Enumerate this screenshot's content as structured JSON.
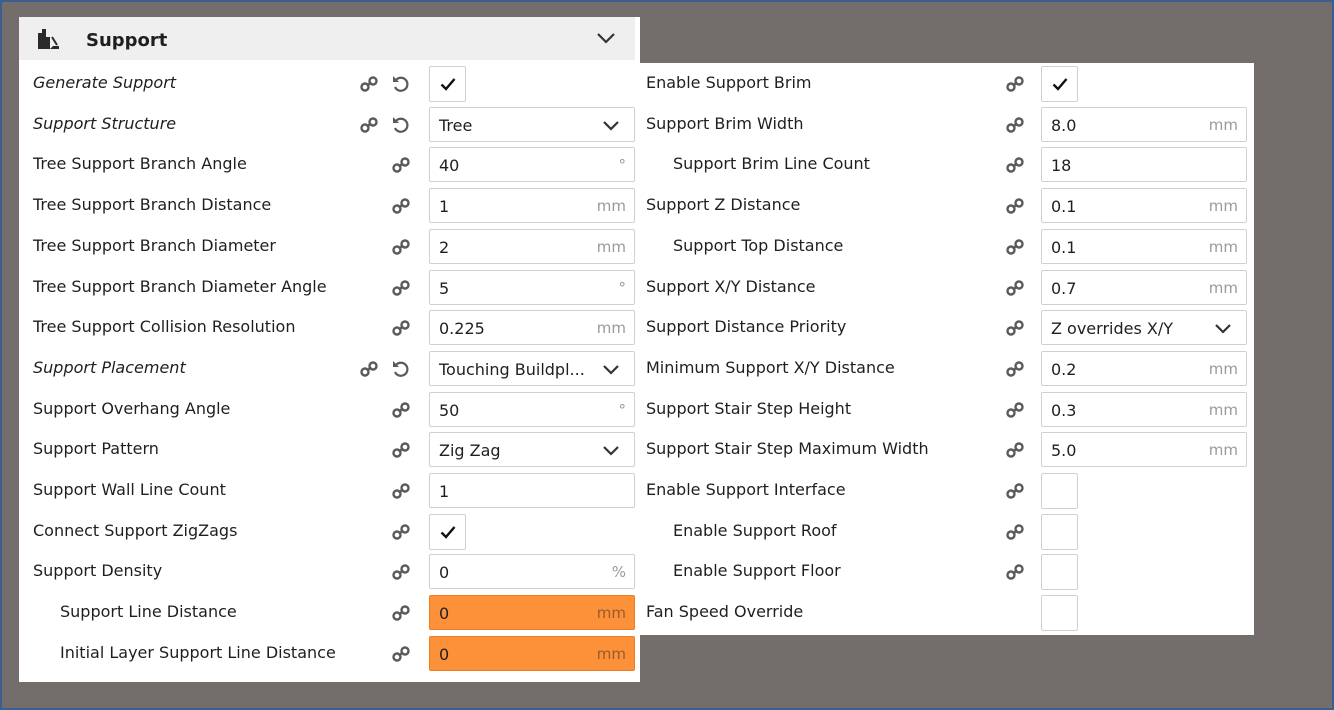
{
  "category": {
    "title": "Support",
    "icon": "support-category-icon"
  },
  "left_settings": [
    {
      "label": "Generate Support",
      "type": "checkbox",
      "checked": true,
      "italic": true,
      "reset": true
    },
    {
      "label": "Support Structure",
      "type": "dropdown",
      "value": "Tree",
      "italic": true,
      "reset": true
    },
    {
      "label": "Tree Support Branch Angle",
      "type": "number",
      "value": "40",
      "unit": "°"
    },
    {
      "label": "Tree Support Branch Distance",
      "type": "number",
      "value": "1",
      "unit": "mm"
    },
    {
      "label": "Tree Support Branch Diameter",
      "type": "number",
      "value": "2",
      "unit": "mm"
    },
    {
      "label": "Tree Support Branch Diameter Angle",
      "type": "number",
      "value": "5",
      "unit": "°"
    },
    {
      "label": "Tree Support Collision Resolution",
      "type": "number",
      "value": "0.225",
      "unit": "mm"
    },
    {
      "label": "Support Placement",
      "type": "dropdown",
      "value": "Touching Buildpl...",
      "italic": true,
      "reset": true
    },
    {
      "label": "Support Overhang Angle",
      "type": "number",
      "value": "50",
      "unit": "°"
    },
    {
      "label": "Support Pattern",
      "type": "dropdown",
      "value": "Zig Zag"
    },
    {
      "label": "Support Wall Line Count",
      "type": "number",
      "value": "1",
      "unit": ""
    },
    {
      "label": "Connect Support ZigZags",
      "type": "checkbox",
      "checked": true
    },
    {
      "label": "Support Density",
      "type": "number",
      "value": "0",
      "unit": "%"
    },
    {
      "label": "Support Line Distance",
      "type": "number",
      "value": "0",
      "unit": "mm",
      "indent": true,
      "warning": true
    },
    {
      "label": "Initial Layer Support Line Distance",
      "type": "number",
      "value": "0",
      "unit": "mm",
      "indent": true,
      "warning": true
    }
  ],
  "right_settings": [
    {
      "label": "Enable Support Brim",
      "type": "checkbox",
      "checked": true
    },
    {
      "label": "Support Brim Width",
      "type": "number",
      "value": "8.0",
      "unit": "mm"
    },
    {
      "label": "Support Brim Line Count",
      "type": "number",
      "value": "18",
      "unit": "",
      "indent": true
    },
    {
      "label": "Support Z Distance",
      "type": "number",
      "value": "0.1",
      "unit": "mm"
    },
    {
      "label": "Support Top Distance",
      "type": "number",
      "value": "0.1",
      "unit": "mm",
      "indent": true
    },
    {
      "label": "Support X/Y Distance",
      "type": "number",
      "value": "0.7",
      "unit": "mm"
    },
    {
      "label": "Support Distance Priority",
      "type": "dropdown",
      "value": "Z overrides X/Y"
    },
    {
      "label": "Minimum Support X/Y Distance",
      "type": "number",
      "value": "0.2",
      "unit": "mm"
    },
    {
      "label": "Support Stair Step Height",
      "type": "number",
      "value": "0.3",
      "unit": "mm"
    },
    {
      "label": "Support Stair Step Maximum Width",
      "type": "number",
      "value": "5.0",
      "unit": "mm"
    },
    {
      "label": "Enable Support Interface",
      "type": "checkbox",
      "checked": false
    },
    {
      "label": "Enable Support Roof",
      "type": "checkbox",
      "checked": false,
      "indent": true
    },
    {
      "label": "Enable Support Floor",
      "type": "checkbox",
      "checked": false,
      "indent": true
    },
    {
      "label": "Fan Speed Override",
      "type": "checkbox",
      "checked": false,
      "nolink": true
    }
  ],
  "colors": {
    "warning": "#fc9139",
    "header": "#efefef",
    "backdrop": "#736e6c",
    "frame": "#3d5f8f"
  }
}
